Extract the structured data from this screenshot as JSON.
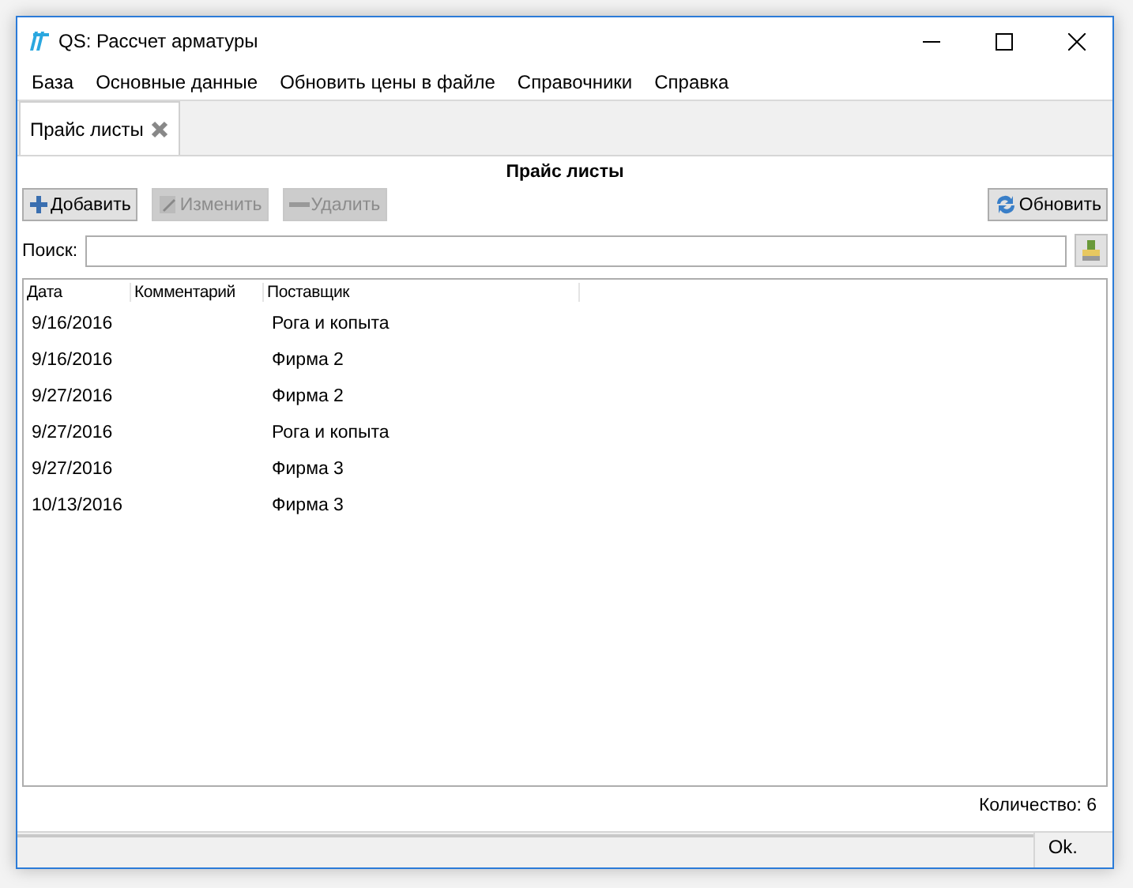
{
  "window": {
    "title": "QS: Рассчет арматуры"
  },
  "menu": [
    "База",
    "Основные данные",
    "Обновить цены в файле",
    "Справочники",
    "Справка"
  ],
  "tabs": [
    {
      "label": "Прайс листы",
      "selected": true
    }
  ],
  "panel_title": "Прайс листы",
  "toolbar": [
    {
      "label": "Добавить",
      "kind": "add",
      "disabled": false
    },
    {
      "label": "Изменить",
      "kind": "edit",
      "disabled": true
    },
    {
      "label": "Удалить",
      "kind": "delete",
      "disabled": true
    }
  ],
  "refresh_button": "Обновить",
  "search": {
    "label": "Поиск:"
  },
  "table": {
    "columns": [
      "Дата",
      "Комментарий",
      "Поставщик"
    ],
    "rows": [
      [
        "9/16/2016",
        "",
        "Рога и копыта"
      ],
      [
        "9/16/2016",
        "",
        "Фирма 2"
      ],
      [
        "9/27/2016",
        "",
        "Фирма 2"
      ],
      [
        "9/27/2016",
        "",
        "Рога и копыта"
      ],
      [
        "9/27/2016",
        "",
        "Фирма 3"
      ],
      [
        "10/13/2016",
        "",
        "Фирма 3"
      ]
    ]
  },
  "count": "Количество: 6",
  "status_bar": "Ok."
}
